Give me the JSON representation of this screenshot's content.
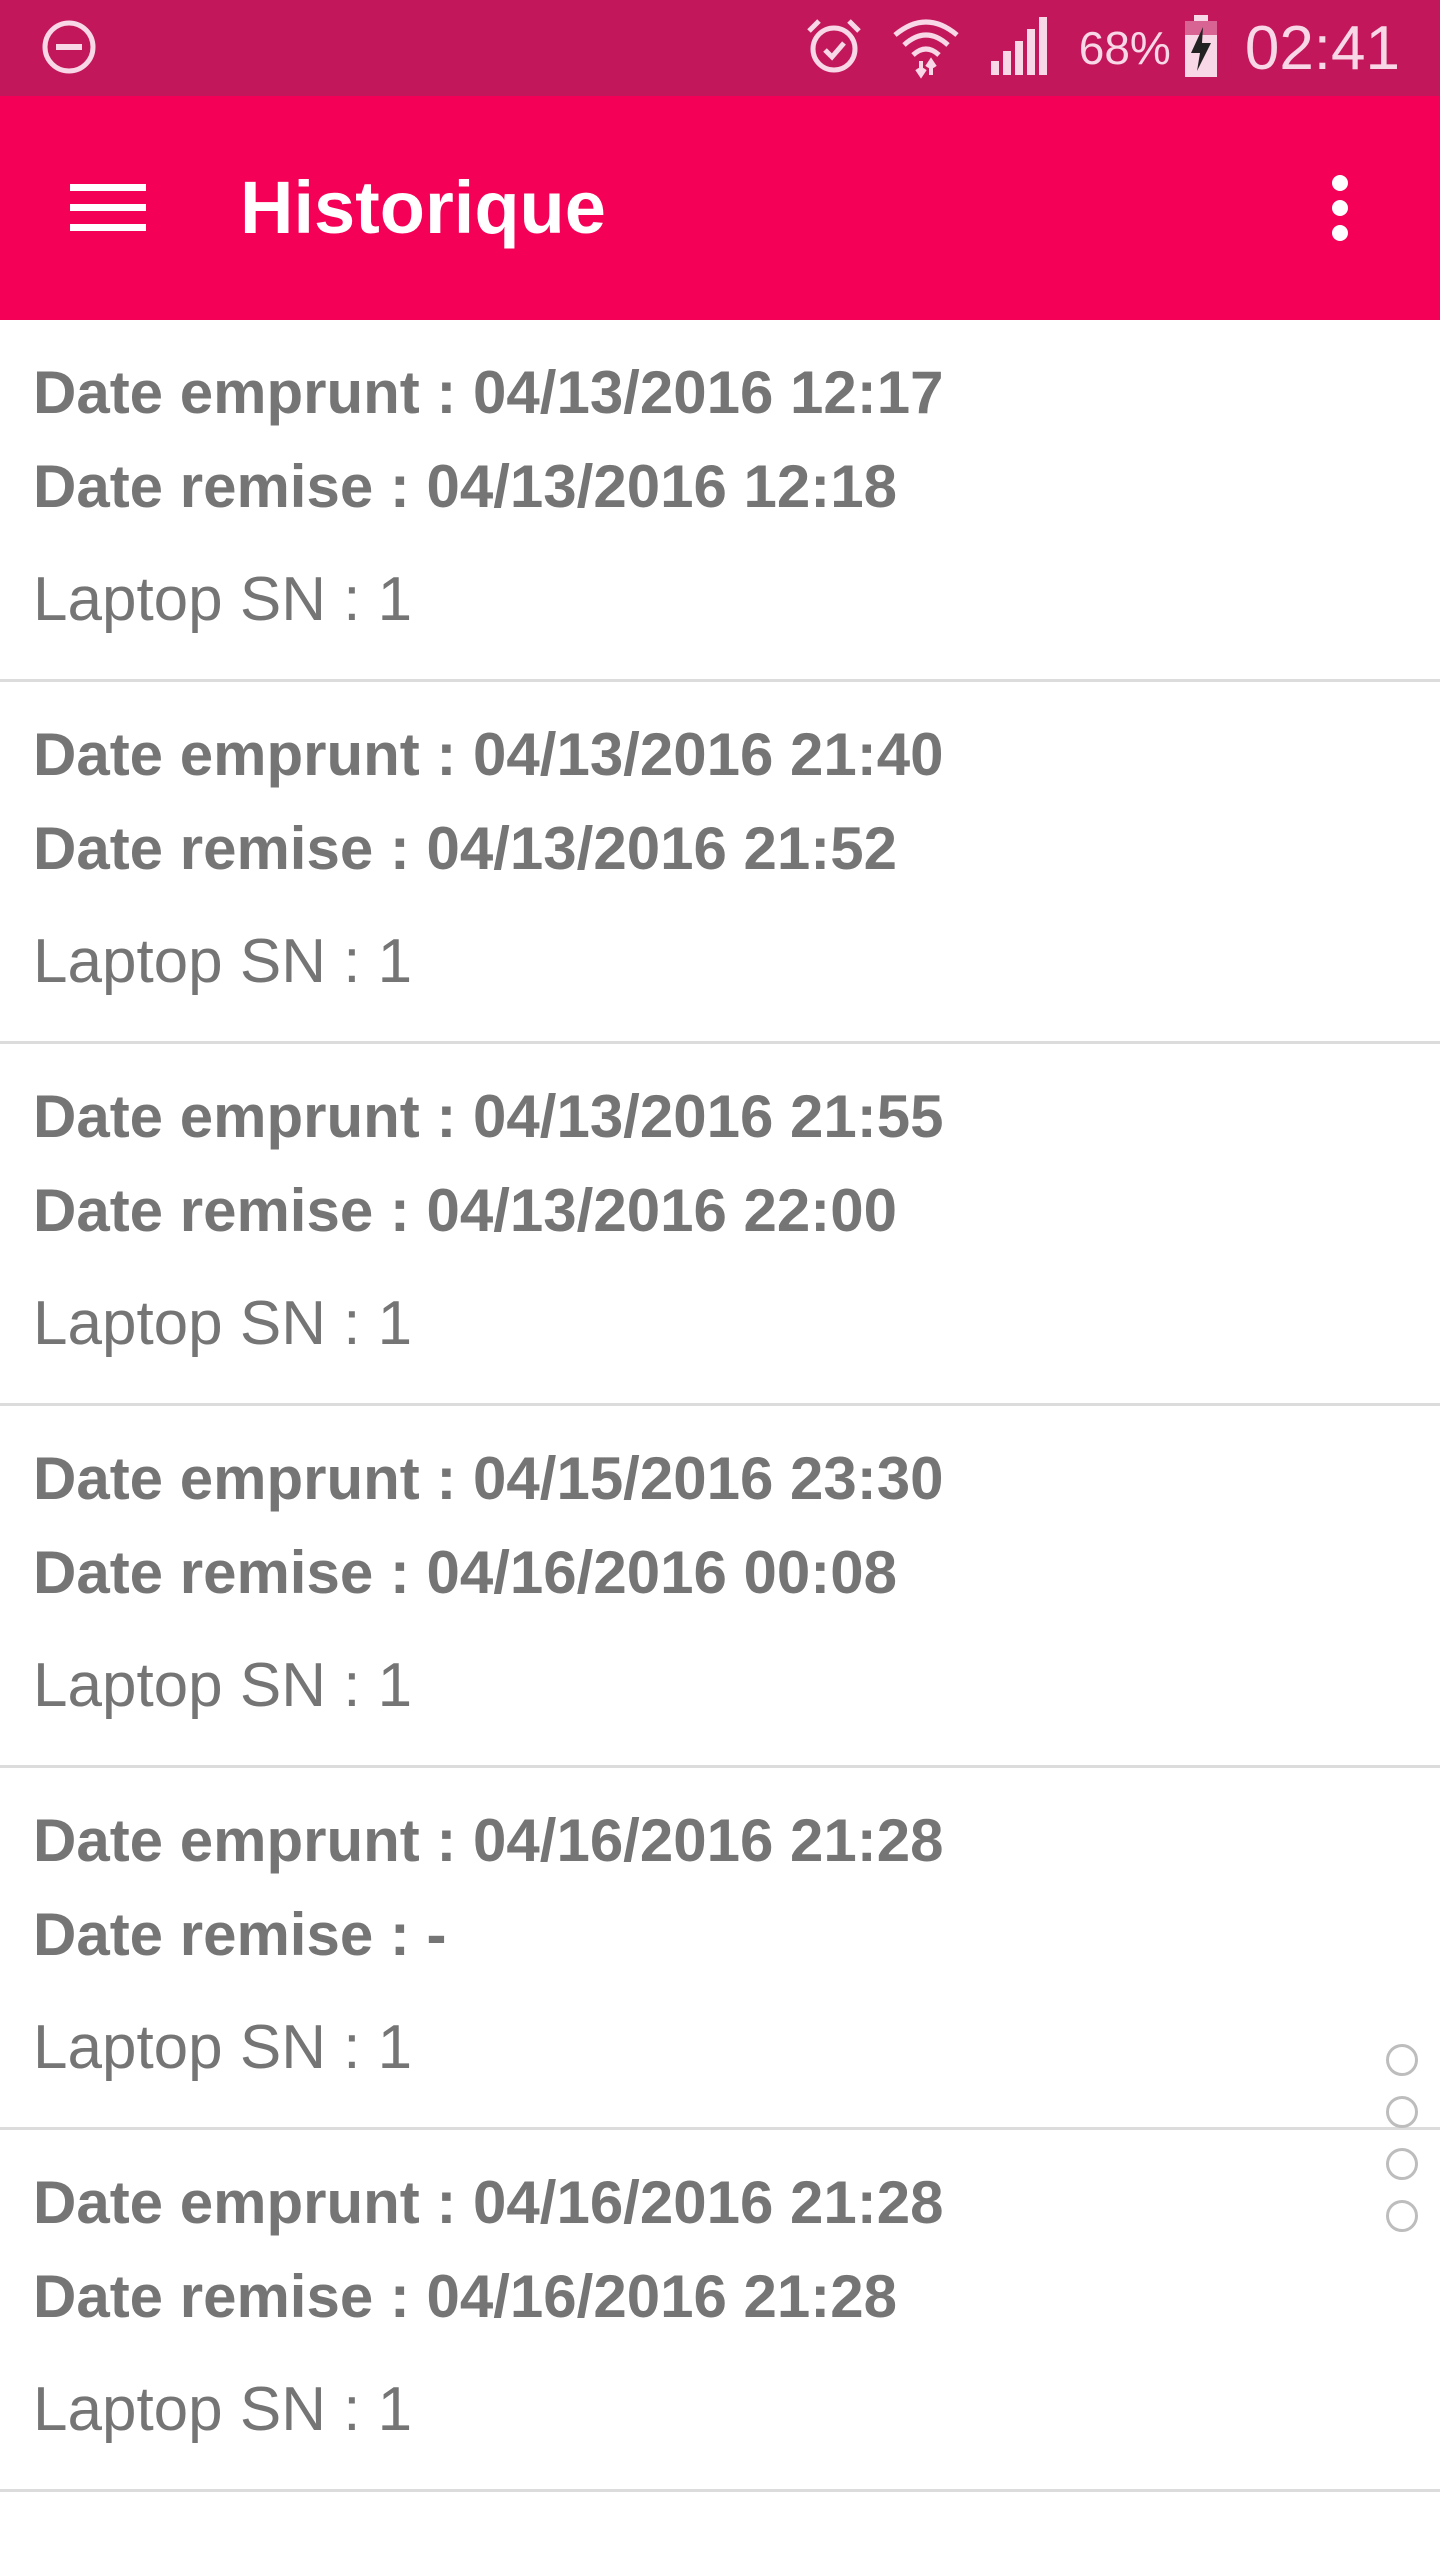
{
  "status_bar": {
    "left_icon": "do-not-disturb-icon",
    "icons": [
      "alarm-icon",
      "wifi-icon",
      "signal-icon"
    ],
    "battery_percent": "68%",
    "battery_icon": "battery-charging-icon",
    "time": "02:41",
    "color": "#c2185b"
  },
  "app_bar": {
    "title": "Historique",
    "menu_icon": "hamburger-menu-icon",
    "overflow_icon": "more-vert-icon",
    "color": "#f50057"
  },
  "history": [
    {
      "borrow": "Date emprunt : 04/13/2016 12:17",
      "return": "Date remise : 04/13/2016 12:18",
      "laptop": "Laptop SN : 1"
    },
    {
      "borrow": "Date emprunt : 04/13/2016 21:40",
      "return": "Date remise : 04/13/2016 21:52",
      "laptop": "Laptop SN : 1"
    },
    {
      "borrow": "Date emprunt : 04/13/2016 21:55",
      "return": "Date remise : 04/13/2016 22:00",
      "laptop": "Laptop SN : 1"
    },
    {
      "borrow": "Date emprunt : 04/15/2016 23:30",
      "return": "Date remise : 04/16/2016 00:08",
      "laptop": "Laptop SN : 1"
    },
    {
      "borrow": "Date emprunt : 04/16/2016 21:28",
      "return": "Date remise : -",
      "laptop": "Laptop SN : 1"
    },
    {
      "borrow": "Date emprunt : 04/16/2016 21:28",
      "return": "Date remise : 04/16/2016 21:28",
      "laptop": "Laptop SN : 1"
    }
  ],
  "text_color": "#757575"
}
